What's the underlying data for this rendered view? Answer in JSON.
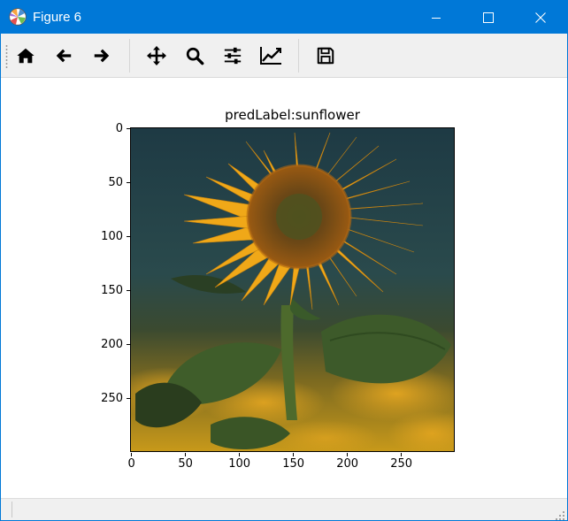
{
  "window": {
    "title": "Figure 6",
    "accent_color": "#0078d7",
    "app_icon": "matplotlib-logo-icon",
    "controls": [
      "minimize-icon",
      "maximize-icon",
      "close-icon"
    ]
  },
  "toolbar": {
    "buttons": [
      {
        "icon": "home-icon",
        "action": "Home"
      },
      {
        "icon": "back-arrow-icon",
        "action": "Back"
      },
      {
        "icon": "forward-arrow-icon",
        "action": "Forward"
      },
      {
        "icon": "pan-move-icon",
        "action": "Pan"
      },
      {
        "icon": "zoom-magnifier-icon",
        "action": "Zoom"
      },
      {
        "icon": "configure-subplots-icon",
        "action": "Subplots"
      },
      {
        "icon": "edit-axis-icon",
        "action": "Customize"
      },
      {
        "icon": "save-floppy-icon",
        "action": "Save"
      }
    ]
  },
  "figure": {
    "title": "predLabel:sunflower",
    "image_extent": [
      0,
      299
    ],
    "y_ticks": [
      "0",
      "50",
      "100",
      "150",
      "200",
      "250"
    ],
    "y_tick_values": [
      0,
      50,
      100,
      150,
      200,
      250
    ],
    "x_ticks": [
      "0",
      "50",
      "100",
      "150",
      "200",
      "250"
    ],
    "x_tick_values": [
      0,
      50,
      100,
      150,
      200,
      250
    ],
    "image_subject": "sunflower-photo"
  }
}
